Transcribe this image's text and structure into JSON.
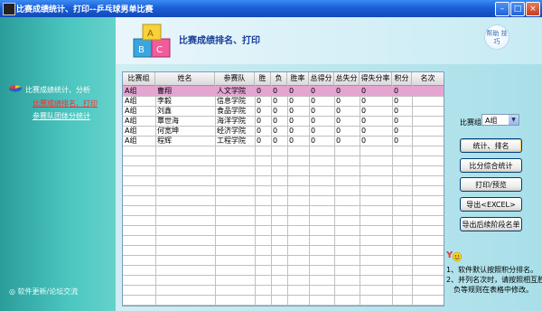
{
  "window": {
    "title": "比赛成绩统计、打印--乒乓球男单比赛",
    "buttons": {
      "minimize": "–",
      "maximize": "□",
      "close": "×"
    }
  },
  "sidebar": {
    "nav_title": "比赛成绩统计、分析",
    "items": [
      {
        "label": "比赛成绩排名、打印",
        "active": true
      },
      {
        "label": "参赛队团体分统计",
        "active": false
      }
    ],
    "footer": "软件更新/论坛交流"
  },
  "header": {
    "title": "比赛成绩排名、打印",
    "help_label": "帮助 技巧"
  },
  "table": {
    "columns": [
      "比赛组",
      "姓名",
      "参赛队",
      "胜",
      "负",
      "胜率",
      "总得分",
      "总失分",
      "得失分率",
      "积分",
      "名次"
    ],
    "rows": [
      [
        "A组",
        "曹翔",
        "人文学院",
        "0",
        "0",
        "0",
        "0",
        "0",
        "0",
        "0",
        ""
      ],
      [
        "A组",
        "李毅",
        "信息学院",
        "0",
        "0",
        "0",
        "0",
        "0",
        "0",
        "0",
        ""
      ],
      [
        "A组",
        "刘鑫",
        "食品学院",
        "0",
        "0",
        "0",
        "0",
        "0",
        "0",
        "0",
        ""
      ],
      [
        "A组",
        "覃世海",
        "海洋学院",
        "0",
        "0",
        "0",
        "0",
        "0",
        "0",
        "0",
        ""
      ],
      [
        "A组",
        "何宽坤",
        "经济学院",
        "0",
        "0",
        "0",
        "0",
        "0",
        "0",
        "0",
        ""
      ],
      [
        "A组",
        "程辉",
        "工程学院",
        "0",
        "0",
        "0",
        "0",
        "0",
        "0",
        "0",
        ""
      ]
    ],
    "selected_row": 0
  },
  "filter": {
    "label": "比赛组",
    "value": "A组"
  },
  "actions": {
    "rank": "统计、排名",
    "compare": "比分综合统计",
    "print": "打印/预览",
    "export_excel": "导出<EXCEL>",
    "export_stage": "导出后续阶段名单"
  },
  "notes": {
    "line1": "1、软件默认按照积分排名。",
    "line2a": "2、并列名次时，请按照相互胜",
    "line2b": "负等规则在表格中修改。"
  },
  "colors": {
    "selected_row": "#e4a5d2",
    "sidebar": "#4cc6c0",
    "title_bar": "#1a5fd8"
  }
}
